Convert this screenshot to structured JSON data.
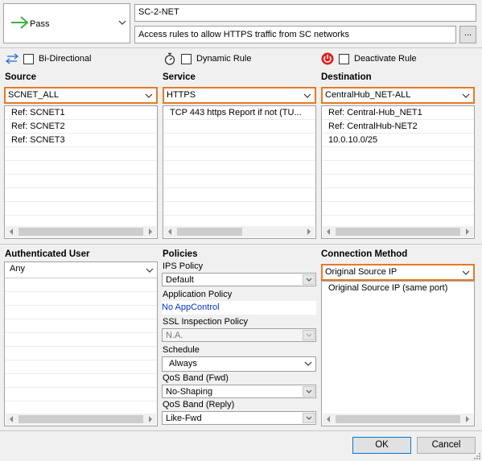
{
  "rule": {
    "action_label": "Pass",
    "name": "SC-2-NET",
    "comment": "Access rules to allow HTTPS traffic from SC networks",
    "comment_button": "..."
  },
  "options": {
    "bidirectional": "Bi-Directional",
    "dynamic_rule": "Dynamic Rule",
    "deactivate_rule": "Deactivate Rule"
  },
  "source": {
    "title": "Source",
    "selected": "SCNET_ALL",
    "items": [
      "Ref: SCNET1",
      "Ref: SCNET2",
      "Ref: SCNET3"
    ]
  },
  "service": {
    "title": "Service",
    "selected": "HTTPS",
    "items": [
      "TCP   443 https   Report if not (TU..."
    ]
  },
  "destination": {
    "title": "Destination",
    "selected": "CentralHub_NET-ALL",
    "items": [
      "Ref: Central-Hub_NET1",
      "Ref: CentralHub-NET2",
      "10.0.10.0/25"
    ]
  },
  "auth_user": {
    "title": "Authenticated User",
    "selected": "Any"
  },
  "policies": {
    "title": "Policies",
    "ips_label": "IPS Policy",
    "ips_value": "Default",
    "app_label": "Application Policy",
    "app_value": "No AppControl",
    "ssl_label": "SSL Inspection Policy",
    "ssl_value": "N.A.",
    "schedule_label": "Schedule",
    "schedule_value": "Always",
    "qos_fwd_label": "QoS Band (Fwd)",
    "qos_fwd_value": "No-Shaping",
    "qos_reply_label": "QoS Band (Reply)",
    "qos_reply_value": "Like-Fwd"
  },
  "connection": {
    "title": "Connection Method",
    "selected": "Original Source IP",
    "items": [
      "Original Source IP (same port)"
    ]
  },
  "buttons": {
    "ok": "OK",
    "cancel": "Cancel"
  },
  "colors": {
    "highlight_border": "#e57a24",
    "pass_arrow": "#3cb043",
    "link_blue": "#0033cc",
    "deactivate_red": "#e02020"
  }
}
